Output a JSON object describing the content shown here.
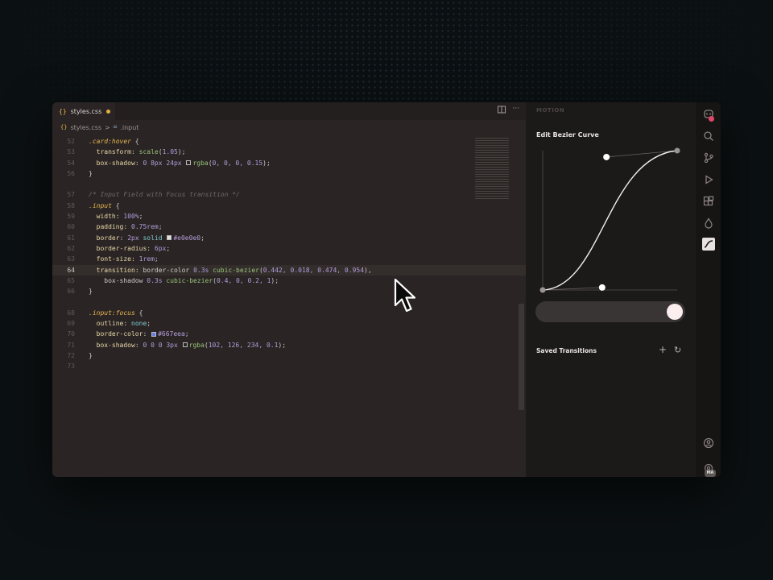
{
  "editor": {
    "tab": {
      "icon": "{}",
      "filename": "styles.css"
    },
    "breadcrumb": {
      "icon": "{}",
      "file": "styles.css",
      "separator": ">",
      "symbol_icon": "⌗",
      "symbol": ".input"
    },
    "lines": [
      {
        "n": "52",
        "segs": [
          {
            "c": "sel",
            "t": ".card:hover"
          },
          {
            "c": "pn",
            "t": " {"
          }
        ]
      },
      {
        "n": "53",
        "segs": [
          {
            "c": "pn",
            "t": "  "
          },
          {
            "c": "prop",
            "t": "transform"
          },
          {
            "c": "pn",
            "t": ": "
          },
          {
            "c": "fn",
            "t": "scale"
          },
          {
            "c": "pn",
            "t": "("
          },
          {
            "c": "num",
            "t": "1.05"
          },
          {
            "c": "pn",
            "t": ");"
          }
        ]
      },
      {
        "n": "54",
        "segs": [
          {
            "c": "pn",
            "t": "  "
          },
          {
            "c": "prop",
            "t": "box-shadow"
          },
          {
            "c": "pn",
            "t": ": "
          },
          {
            "c": "num",
            "t": "0 8px 24px "
          },
          {
            "c": "swatch",
            "t": "",
            "color": "#2a2524"
          },
          {
            "c": "fn",
            "t": "rgba"
          },
          {
            "c": "pn",
            "t": "("
          },
          {
            "c": "num",
            "t": "0, 0, 0, 0.15"
          },
          {
            "c": "pn",
            "t": ");"
          }
        ]
      },
      {
        "n": "56",
        "segs": [
          {
            "c": "pn",
            "t": "}"
          }
        ]
      },
      {
        "n": "",
        "segs": []
      },
      {
        "n": "57",
        "segs": [
          {
            "c": "cm",
            "t": "/* Input Field with Focus transition */"
          }
        ]
      },
      {
        "n": "58",
        "segs": [
          {
            "c": "sel",
            "t": ".input"
          },
          {
            "c": "pn",
            "t": " {"
          }
        ]
      },
      {
        "n": "59",
        "segs": [
          {
            "c": "pn",
            "t": "  "
          },
          {
            "c": "prop",
            "t": "width"
          },
          {
            "c": "pn",
            "t": ": "
          },
          {
            "c": "num",
            "t": "100%"
          },
          {
            "c": "pn",
            "t": ";"
          }
        ]
      },
      {
        "n": "60",
        "segs": [
          {
            "c": "pn",
            "t": "  "
          },
          {
            "c": "prop",
            "t": "padding"
          },
          {
            "c": "pn",
            "t": ": "
          },
          {
            "c": "num",
            "t": "0.75rem"
          },
          {
            "c": "pn",
            "t": ";"
          }
        ]
      },
      {
        "n": "61",
        "segs": [
          {
            "c": "pn",
            "t": "  "
          },
          {
            "c": "prop",
            "t": "border"
          },
          {
            "c": "pn",
            "t": ": "
          },
          {
            "c": "num",
            "t": "2px "
          },
          {
            "c": "kw",
            "t": "solid "
          },
          {
            "c": "swatch",
            "t": "",
            "color": "#e0e0e0"
          },
          {
            "c": "num",
            "t": "#e0e0e0"
          },
          {
            "c": "pn",
            "t": ";"
          }
        ]
      },
      {
        "n": "62",
        "segs": [
          {
            "c": "pn",
            "t": "  "
          },
          {
            "c": "prop",
            "t": "border-radius"
          },
          {
            "c": "pn",
            "t": ": "
          },
          {
            "c": "num",
            "t": "6px"
          },
          {
            "c": "pn",
            "t": ";"
          }
        ]
      },
      {
        "n": "63",
        "segs": [
          {
            "c": "pn",
            "t": "  "
          },
          {
            "c": "prop",
            "t": "font-size"
          },
          {
            "c": "pn",
            "t": ": "
          },
          {
            "c": "num",
            "t": "1rem"
          },
          {
            "c": "pn",
            "t": ";"
          }
        ]
      },
      {
        "n": "64",
        "current": true,
        "segs": [
          {
            "c": "pn",
            "t": "  "
          },
          {
            "c": "prop",
            "t": "transition"
          },
          {
            "c": "pn",
            "t": ": border-color "
          },
          {
            "c": "num",
            "t": "0.3s "
          },
          {
            "c": "fn",
            "t": "cubic-bezier"
          },
          {
            "c": "pn",
            "t": "("
          },
          {
            "c": "num",
            "t": "0.442, 0.018, 0.474, 0.954"
          },
          {
            "c": "pn",
            "t": "),"
          }
        ]
      },
      {
        "n": "65",
        "segs": [
          {
            "c": "pn",
            "t": "    box-shadow "
          },
          {
            "c": "num",
            "t": "0.3s "
          },
          {
            "c": "fn",
            "t": "cubic-bezier"
          },
          {
            "c": "pn",
            "t": "("
          },
          {
            "c": "num",
            "t": "0.4, 0, 0.2, 1"
          },
          {
            "c": "pn",
            "t": ");"
          }
        ]
      },
      {
        "n": "66",
        "segs": [
          {
            "c": "pn",
            "t": "}"
          }
        ]
      },
      {
        "n": "",
        "segs": []
      },
      {
        "n": "68",
        "segs": [
          {
            "c": "sel",
            "t": ".input:focus"
          },
          {
            "c": "pn",
            "t": " {"
          }
        ]
      },
      {
        "n": "69",
        "segs": [
          {
            "c": "pn",
            "t": "  "
          },
          {
            "c": "prop",
            "t": "outline"
          },
          {
            "c": "pn",
            "t": ": "
          },
          {
            "c": "kw",
            "t": "none"
          },
          {
            "c": "pn",
            "t": ";"
          }
        ]
      },
      {
        "n": "70",
        "segs": [
          {
            "c": "pn",
            "t": "  "
          },
          {
            "c": "prop",
            "t": "border-color"
          },
          {
            "c": "pn",
            "t": ": "
          },
          {
            "c": "swatch",
            "t": "",
            "color": "#667eea"
          },
          {
            "c": "num",
            "t": "#667eea"
          },
          {
            "c": "pn",
            "t": ";"
          }
        ]
      },
      {
        "n": "71",
        "segs": [
          {
            "c": "pn",
            "t": "  "
          },
          {
            "c": "prop",
            "t": "box-shadow"
          },
          {
            "c": "pn",
            "t": ": "
          },
          {
            "c": "num",
            "t": "0 0 0 3px "
          },
          {
            "c": "swatch",
            "t": "",
            "color": "#2a2524"
          },
          {
            "c": "fn",
            "t": "rgba"
          },
          {
            "c": "pn",
            "t": "("
          },
          {
            "c": "num",
            "t": "102, 126, 234, 0.1"
          },
          {
            "c": "pn",
            "t": ");"
          }
        ]
      },
      {
        "n": "72",
        "segs": [
          {
            "c": "pn",
            "t": "}"
          }
        ]
      },
      {
        "n": "73",
        "segs": []
      }
    ]
  },
  "motion": {
    "panel_title": "MOTION",
    "edit_title": "Edit Bezier Curve",
    "bezier": [
      0.442,
      0.018,
      0.474,
      0.954
    ],
    "slider_value": 1.0,
    "saved_title": "Saved Transitions",
    "add_icon": "+",
    "refresh_icon": "↻"
  },
  "activity": {
    "account_badge": "MA"
  },
  "colors": {
    "accent": "#e0b13f",
    "notification": "#e0486a",
    "curve": "#ffffff",
    "panel_bg": "#1c1919",
    "editor_bg": "#2a2524"
  }
}
